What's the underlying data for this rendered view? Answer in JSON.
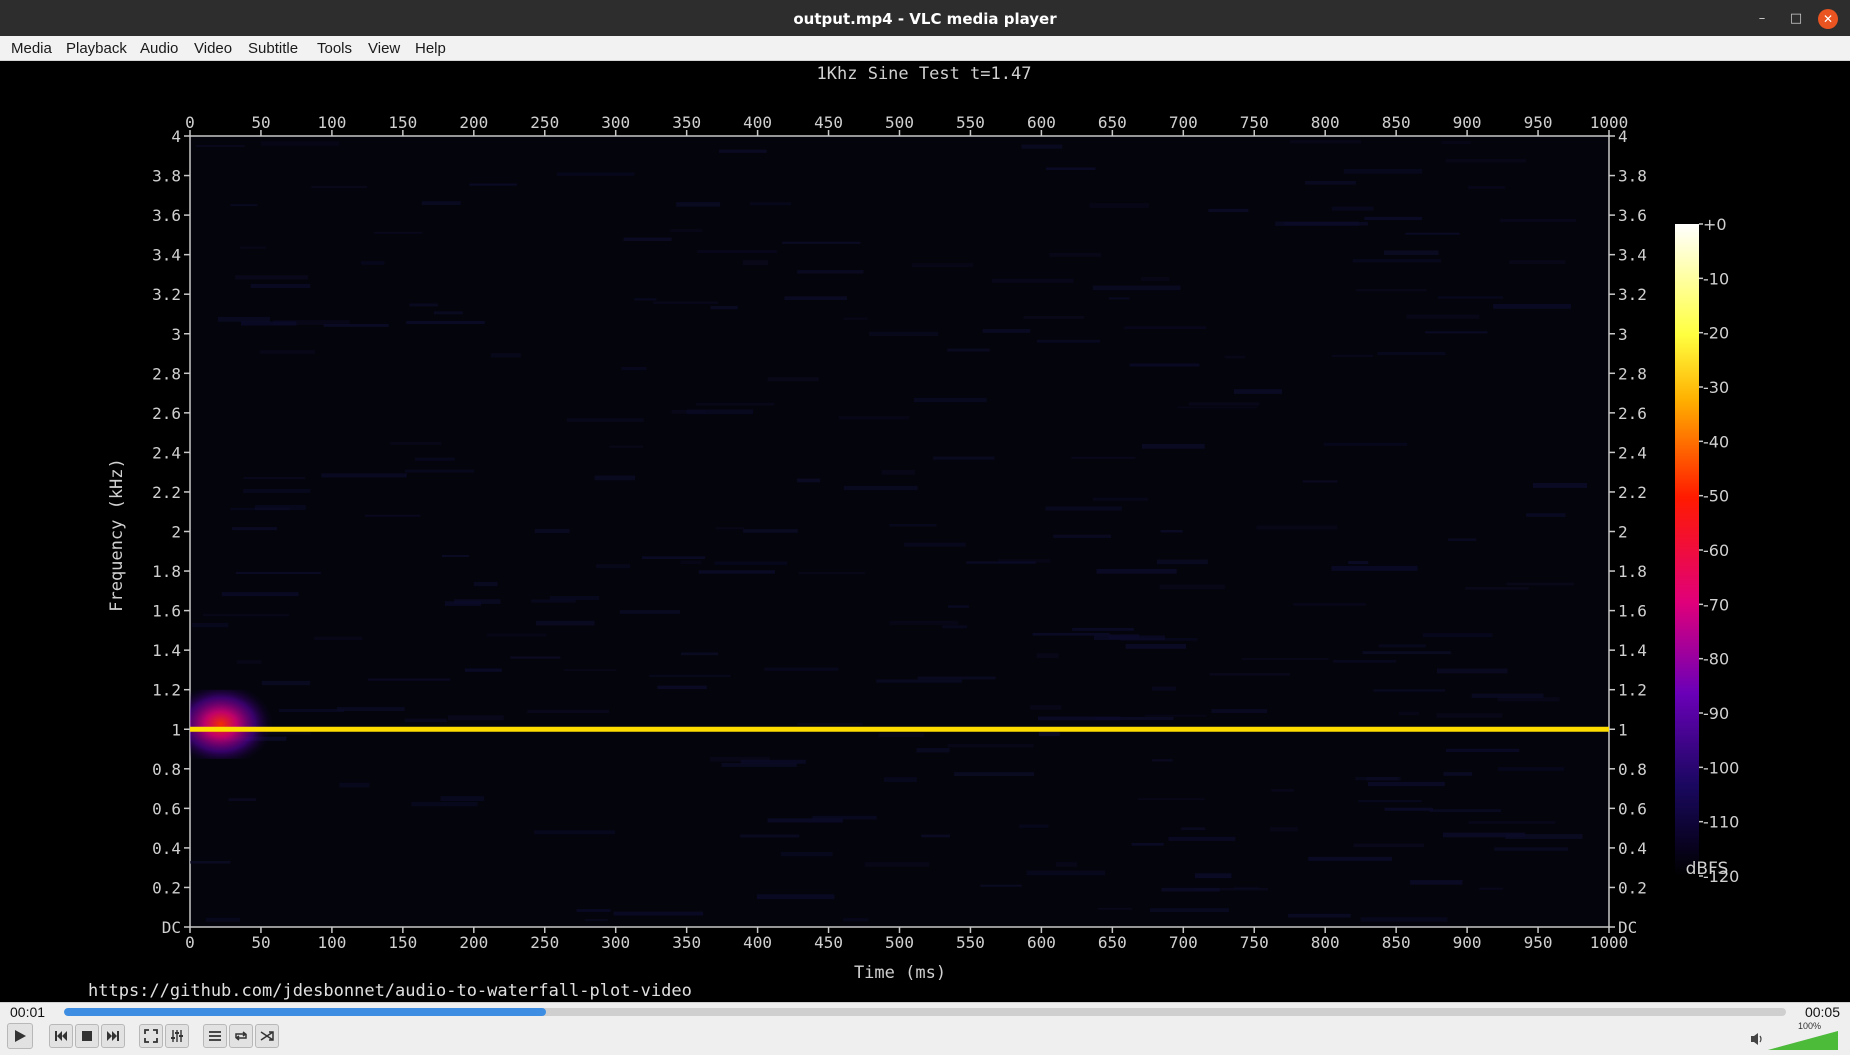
{
  "window": {
    "title": "output.mp4 - VLC media player"
  },
  "menu": [
    "Media",
    "Playback",
    "Audio",
    "Video",
    "Subtitle",
    "Tools",
    "View",
    "Help"
  ],
  "controls": {
    "elapsed": "00:01",
    "total": "00:05",
    "progress": 0.28,
    "volume": "100%"
  },
  "overlay": {
    "url": "https://github.com/jdesbonnet/audio-to-waterfall-plot-video"
  },
  "chart_data": {
    "type": "heatmap",
    "title": "1Khz Sine Test t=1.47",
    "xlabel": "Time (ms)",
    "ylabel": "Frequency (kHz)",
    "xlim": [
      0,
      1000
    ],
    "ylim": [
      0,
      4
    ],
    "x_ticks": [
      "0",
      "50",
      "100",
      "150",
      "200",
      "250",
      "300",
      "350",
      "400",
      "450",
      "500",
      "550",
      "600",
      "650",
      "700",
      "750",
      "800",
      "850",
      "900",
      "950",
      "1000"
    ],
    "y_ticks": [
      "DC",
      "0.2",
      "0.4",
      "0.6",
      "0.8",
      "1",
      "1.2",
      "1.4",
      "1.6",
      "1.8",
      "2",
      "2.2",
      "2.4",
      "2.6",
      "2.8",
      "3",
      "3.2",
      "3.4",
      "3.6",
      "3.8",
      "4"
    ],
    "colorbar": {
      "label": "dBFS",
      "ticks": [
        "+0",
        "-10",
        "-20",
        "-30",
        "-40",
        "-50",
        "-60",
        "-70",
        "-80",
        "-90",
        "-100",
        "-110",
        "-120"
      ],
      "range": [
        -120,
        0
      ]
    },
    "series": [
      {
        "frequency_khz": 1.0,
        "time_ms": [
          0,
          1000
        ],
        "level_dbfs": -18,
        "color": "#ffdd00"
      }
    ],
    "burst": {
      "frequency_khz": 1.0,
      "time_ms": [
        0,
        62
      ],
      "bandwidth_khz": [
        0.85,
        1.2
      ]
    },
    "colors": {
      "background": "#000000",
      "axis": "#d0d0d0",
      "trace": "#ffdd00",
      "accent": "#3d8ee3"
    }
  }
}
